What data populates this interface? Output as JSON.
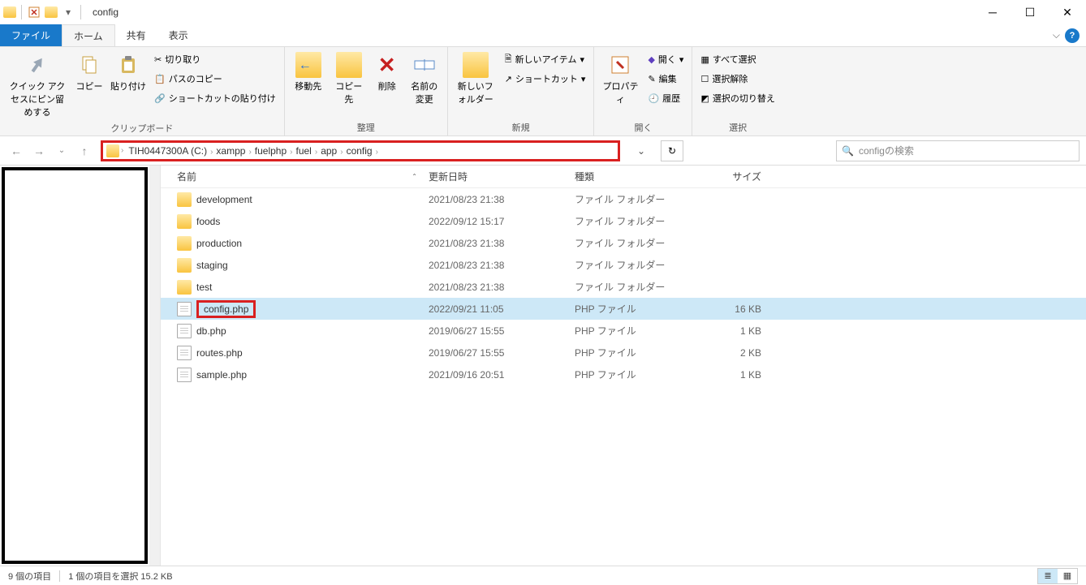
{
  "window": {
    "title": "config"
  },
  "tabs": {
    "file": "ファイル",
    "home": "ホーム",
    "share": "共有",
    "view": "表示"
  },
  "ribbon": {
    "clipboard": {
      "label": "クリップボード",
      "pin": "クイック アクセスにピン留めする",
      "copy": "コピー",
      "paste": "貼り付け",
      "cut": "切り取り",
      "copypath": "パスのコピー",
      "pasteshortcut": "ショートカットの貼り付け"
    },
    "organize": {
      "label": "整理",
      "moveto": "移動先",
      "copyto": "コピー先",
      "delete": "削除",
      "rename": "名前の変更"
    },
    "new": {
      "label": "新規",
      "newfolder": "新しいフォルダー",
      "newitem": "新しいアイテム",
      "shortcut": "ショートカット"
    },
    "open": {
      "label": "開く",
      "properties": "プロパティ",
      "open": "開く",
      "edit": "編集",
      "history": "履歴"
    },
    "select": {
      "label": "選択",
      "selectall": "すべて選択",
      "selectnone": "選択解除",
      "invert": "選択の切り替え"
    }
  },
  "breadcrumb": [
    "TIH0447300A (C:)",
    "xampp",
    "fuelphp",
    "fuel",
    "app",
    "config"
  ],
  "search": {
    "placeholder": "configの検索"
  },
  "columns": {
    "name": "名前",
    "date": "更新日時",
    "type": "種類",
    "size": "サイズ"
  },
  "files": [
    {
      "name": "development",
      "date": "2021/08/23 21:38",
      "type": "ファイル フォルダー",
      "size": "",
      "icon": "folder",
      "selected": false,
      "hl": false
    },
    {
      "name": "foods",
      "date": "2022/09/12 15:17",
      "type": "ファイル フォルダー",
      "size": "",
      "icon": "folder",
      "selected": false,
      "hl": false
    },
    {
      "name": "production",
      "date": "2021/08/23 21:38",
      "type": "ファイル フォルダー",
      "size": "",
      "icon": "folder",
      "selected": false,
      "hl": false
    },
    {
      "name": "staging",
      "date": "2021/08/23 21:38",
      "type": "ファイル フォルダー",
      "size": "",
      "icon": "folder",
      "selected": false,
      "hl": false
    },
    {
      "name": "test",
      "date": "2021/08/23 21:38",
      "type": "ファイル フォルダー",
      "size": "",
      "icon": "folder",
      "selected": false,
      "hl": false
    },
    {
      "name": "config.php",
      "date": "2022/09/21 11:05",
      "type": "PHP ファイル",
      "size": "16 KB",
      "icon": "file",
      "selected": true,
      "hl": true
    },
    {
      "name": "db.php",
      "date": "2019/06/27 15:55",
      "type": "PHP ファイル",
      "size": "1 KB",
      "icon": "file",
      "selected": false,
      "hl": false
    },
    {
      "name": "routes.php",
      "date": "2019/06/27 15:55",
      "type": "PHP ファイル",
      "size": "2 KB",
      "icon": "file",
      "selected": false,
      "hl": false
    },
    {
      "name": "sample.php",
      "date": "2021/09/16 20:51",
      "type": "PHP ファイル",
      "size": "1 KB",
      "icon": "file",
      "selected": false,
      "hl": false
    }
  ],
  "status": {
    "items": "9 個の項目",
    "selected": "1 個の項目を選択 15.2 KB"
  }
}
